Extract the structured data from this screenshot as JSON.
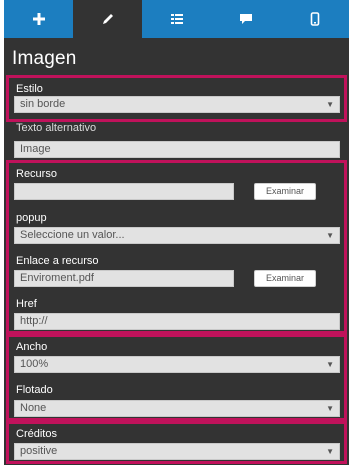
{
  "section_title": "Imagen",
  "tabs": [
    {
      "icon": "plus-icon"
    },
    {
      "icon": "pencil-icon",
      "active": true
    },
    {
      "icon": "list-icon"
    },
    {
      "icon": "comment-icon"
    },
    {
      "icon": "mobile-icon"
    }
  ],
  "fields": {
    "estilo": {
      "label": "Estilo",
      "value": "sin borde"
    },
    "texto_alternativo": {
      "label": "Texto alternativo",
      "value": "Image"
    },
    "recurso": {
      "label": "Recurso",
      "value": "",
      "button": "Examinar"
    },
    "popup": {
      "label": "popup",
      "value": "Seleccione un valor..."
    },
    "enlace_recurso": {
      "label": "Enlace a recurso",
      "value": "Enviroment.pdf",
      "button": "Examinar"
    },
    "href": {
      "label": "Href",
      "value": "http://"
    },
    "ancho": {
      "label": "Ancho",
      "value": "100%"
    },
    "flotado": {
      "label": "Flotado",
      "value": "None"
    },
    "creditos": {
      "label": "Créditos",
      "value": "positive"
    }
  },
  "colors": {
    "panel_bg": "#333333",
    "tab_blue": "#1c7ec0",
    "highlight": "#c0125b",
    "field_bg": "#e2e2e2"
  }
}
